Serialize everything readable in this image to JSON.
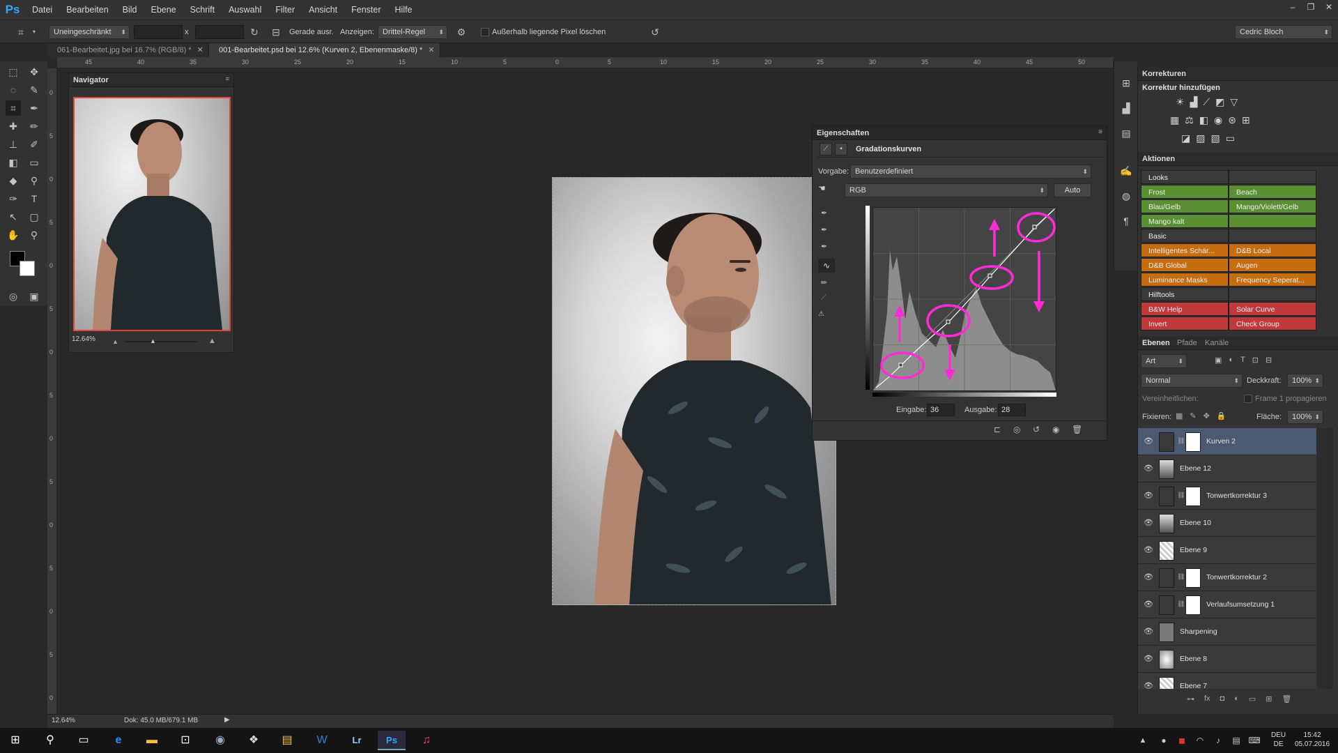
{
  "app": {
    "logo": "Ps"
  },
  "menu": [
    "Datei",
    "Bearbeiten",
    "Bild",
    "Ebene",
    "Schrift",
    "Auswahl",
    "Filter",
    "Ansicht",
    "Fenster",
    "Hilfe"
  ],
  "window_controls": {
    "minimize": "–",
    "restore": "❐",
    "close": "✕"
  },
  "options": {
    "ratio": "Uneingeschränkt",
    "x_sep": "x",
    "straighten": "Gerade ausr.",
    "show_label": "Anzeigen:",
    "overlay": "Drittel-Regel",
    "delete_outside": "Außerhalb liegende Pixel löschen",
    "user": "Cedric Bloch"
  },
  "tabs": [
    {
      "label": "061-Bearbeitet.jpg bei 16.7% (RGB/8) *",
      "close": "✕"
    },
    {
      "label": "001-Bearbeitet.psd bei 12.6% (Kurven 2, Ebenenmaske/8) *",
      "close": "✕"
    }
  ],
  "ruler_h": [
    "45",
    "40",
    "35",
    "30",
    "25",
    "20",
    "15",
    "10",
    "5",
    "0",
    "5",
    "10",
    "15",
    "20",
    "25",
    "30",
    "35",
    "40",
    "45",
    "50"
  ],
  "ruler_v": [
    "0",
    "5",
    "0",
    "5",
    "0",
    "5",
    "0",
    "5",
    "0",
    "5",
    "0",
    "5",
    "0",
    "5",
    "0"
  ],
  "status": {
    "zoom": "12.64%",
    "doc": "Dok: 45.0 MB/679.1 MB"
  },
  "navigator": {
    "title": "Navigator",
    "zoom": "12.64%"
  },
  "properties": {
    "title": "Eigenschaften",
    "sub": "Gradationskurven",
    "preset_label": "Vorgabe:",
    "preset": "Benutzerdefiniert",
    "channel": "RGB",
    "auto": "Auto",
    "input_label": "Eingabe:",
    "input": "36",
    "output_label": "Ausgabe:",
    "output": "28"
  },
  "corrections": {
    "title": "Korrekturen",
    "add": "Korrektur hinzufügen"
  },
  "actions": {
    "title": "Aktionen",
    "rows": [
      {
        "left": "Looks",
        "right": "",
        "color": "#3a3a3a"
      },
      {
        "left": "Frost",
        "right": "Beach",
        "color": "#5a8f34"
      },
      {
        "left": "Blau/Gelb",
        "right": "Mango/Violett/Gelb",
        "color": "#5a8f34"
      },
      {
        "left": "Mango kalt",
        "right": "",
        "color": "#5a8f34"
      },
      {
        "left": "Basic",
        "right": "",
        "color": "#3a3a3a"
      },
      {
        "left": "Intelligentes Schär...",
        "right": "D&B Local",
        "color": "#c66d12"
      },
      {
        "left": "D&B Global",
        "right": "Augen",
        "color": "#c66d12"
      },
      {
        "left": "Luminance Masks",
        "right": "Frequency Seperat...",
        "color": "#c66d12"
      },
      {
        "left": "Hilftools",
        "right": "",
        "color": "#3a3a3a"
      },
      {
        "left": "B&W Help",
        "right": "Solar Curve",
        "color": "#c0393b"
      },
      {
        "left": "Invert",
        "right": "Check Group",
        "color": "#c0393b"
      }
    ]
  },
  "layers_panel": {
    "tabs": [
      "Ebenen",
      "Pfade",
      "Kanäle"
    ],
    "kind": "Art",
    "blend": "Normal",
    "opacity_label": "Deckkraft:",
    "opacity": "100%",
    "unify_label": "Vereinheitlichen:",
    "propagate": "Frame 1 propagieren",
    "lock_label": "Fixieren:",
    "fill_label": "Fläche:",
    "fill": "100%",
    "layers": [
      {
        "name": "Kurven 2",
        "type": "curves"
      },
      {
        "name": "Ebene 12",
        "type": "photo"
      },
      {
        "name": "Tonwertkorrektur 3",
        "type": "levels"
      },
      {
        "name": "Ebene 10",
        "type": "photo"
      },
      {
        "name": "Ebene 9",
        "type": "transparent"
      },
      {
        "name": "Tonwertkorrektur 2",
        "type": "levels"
      },
      {
        "name": "Verlaufsumsetzung 1",
        "type": "gradientmap"
      },
      {
        "name": "Sharpening",
        "type": "gray"
      },
      {
        "name": "Ebene 8",
        "type": "soft"
      },
      {
        "name": "Ebene 7",
        "type": "transparent"
      }
    ]
  },
  "taskbar": {
    "clock": "15:42",
    "date": "05.07.2016",
    "lang1": "DEU",
    "lang2": "DE"
  }
}
